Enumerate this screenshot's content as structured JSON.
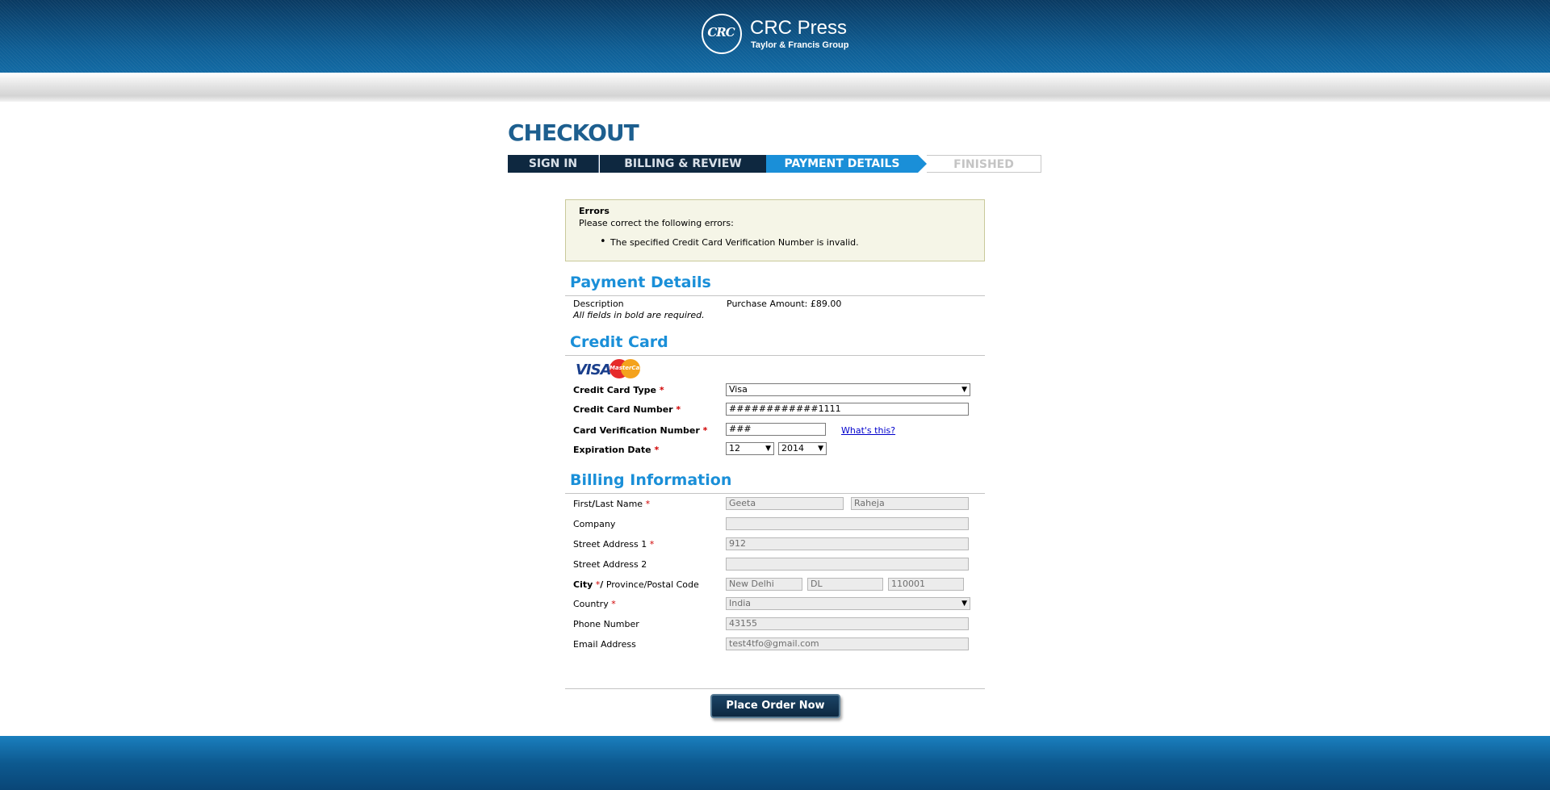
{
  "header": {
    "logo_mark": "CRC",
    "logo_name": "CRC Press",
    "logo_sub": "Taylor & Francis Group"
  },
  "page_title": "CHECKOUT",
  "steps": [
    "SIGN IN",
    "BILLING & REVIEW",
    "PAYMENT DETAILS",
    "FINISHED"
  ],
  "errors": {
    "title": "Errors",
    "message": "Please correct the following errors:",
    "items": [
      "The specified Credit Card Verification Number is invalid."
    ]
  },
  "payment": {
    "title": "Payment Details",
    "description_label": "Description",
    "purchase_amount": "Purchase Amount: £89.00",
    "required_note": "All fields in bold are required."
  },
  "credit_card": {
    "title": "Credit Card",
    "logos": [
      "VISA",
      "MasterCard"
    ],
    "type_label": "Credit Card Type",
    "type_value": "Visa",
    "number_label": "Credit Card Number",
    "number_value": "############1111",
    "cvn_label": "Card Verification Number",
    "cvn_value": "###",
    "whats_this": "What's this?",
    "expiry_label": "Expiration Date",
    "expiry_month": "12",
    "expiry_year": "2014"
  },
  "billing": {
    "title": "Billing Information",
    "name_label_1": "First",
    "name_label_2": "Last Name",
    "first_name": "Geeta",
    "last_name": "Raheja",
    "company_label": "Company",
    "company": "",
    "street1_label": "Street Address 1",
    "street1": "912",
    "street2_label": "Street Address 2",
    "street2": "",
    "city_label": "City",
    "region_label": "Province/Postal Code",
    "city": "New Delhi",
    "province": "DL",
    "postal": "110001",
    "country_label": "Country",
    "country": "India",
    "phone_label": "Phone Number",
    "phone": "43155",
    "email_label": "Email Address",
    "email": "test4tfo@gmail.com"
  },
  "actions": {
    "place_order": "Place Order Now"
  },
  "symbols": {
    "required": "*",
    "slash": "/",
    "select_arrow": "▼",
    "bullet": "•"
  },
  "colors": {
    "header_blue": "#0f5f96",
    "accent_blue": "#1a8fd8",
    "step_dark": "#0e2840",
    "required_red": "#d00000",
    "error_bg": "#f5f5e7"
  }
}
